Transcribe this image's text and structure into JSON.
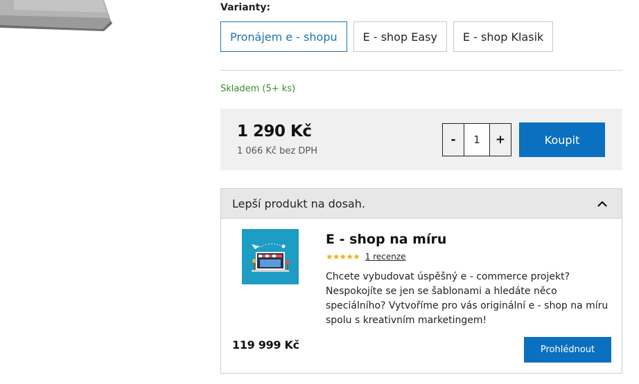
{
  "variants": {
    "label": "Varianty:",
    "items": [
      {
        "label": "Pronájem e - shopu"
      },
      {
        "label": "E - shop Easy"
      },
      {
        "label": "E - shop Klasik"
      }
    ]
  },
  "stock": "Skladem (5+ ks)",
  "price": {
    "main": "1 290 Kč",
    "without_vat": "1 066 Kč bez DPH"
  },
  "quantity": {
    "minus": "-",
    "value": "1",
    "plus": "+"
  },
  "buy_label": "Koupit",
  "upsell": {
    "title": "Lepší produkt na dosah.",
    "icon": "chevron-up-icon",
    "product": {
      "name": "E - shop na míru",
      "stars": "★★★★★",
      "rating_value": 5,
      "reviews": "1 recenze",
      "description": "Chcete vybudovat úspěšný e - commerce projekt? Nespokojíte se jen se šablonami a hledáte něco speciálního? Vytvoříme pro vás originální e - shop na míru spolu s kreativním marketingem!",
      "price": "119 999 Kč",
      "button": "Prohlédnout"
    }
  },
  "colors": {
    "accent": "#0b70c0",
    "stock": "#3a8a2c",
    "stars": "#f2b01e"
  }
}
